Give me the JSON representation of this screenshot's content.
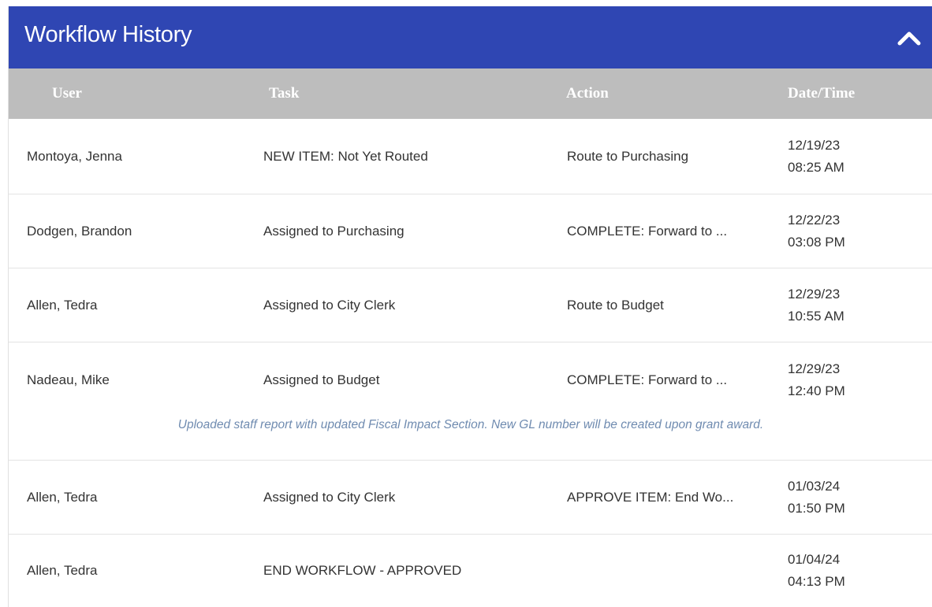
{
  "panel": {
    "title": "Workflow History",
    "collapse_icon": "chevron-up-icon",
    "header_color": "#2f46b3",
    "column_header_color": "#bdbdbd"
  },
  "columns": {
    "user": "User",
    "task": "Task",
    "action": "Action",
    "datetime": "Date/Time"
  },
  "rows": [
    {
      "user": "Montoya, Jenna",
      "task": "NEW ITEM: Not Yet Routed",
      "action": "Route to Purchasing",
      "date": "12/19/23",
      "time": "08:25 AM"
    },
    {
      "user": "Dodgen, Brandon",
      "task": "Assigned to Purchasing",
      "action": "COMPLETE: Forward to ...",
      "date": "12/22/23",
      "time": "03:08 PM"
    },
    {
      "user": "Allen, Tedra",
      "task": "Assigned to City Clerk",
      "action": "Route to Budget",
      "date": "12/29/23",
      "time": "10:55 AM"
    },
    {
      "user": "Nadeau, Mike",
      "task": "Assigned to Budget",
      "action": "COMPLETE: Forward to ...",
      "date": "12/29/23",
      "time": "12:40 PM"
    },
    {
      "user": "Allen, Tedra",
      "task": "Assigned to City Clerk",
      "action": "APPROVE ITEM: End Wo...",
      "date": "01/03/24",
      "time": "01:50 PM"
    },
    {
      "user": "Allen, Tedra",
      "task": "END WORKFLOW - APPROVED",
      "action": "",
      "date": "01/04/24",
      "time": "04:13 PM"
    }
  ],
  "notes": {
    "row4": "Uploaded staff report with updated Fiscal Impact Section. New GL number will be created upon grant award."
  }
}
